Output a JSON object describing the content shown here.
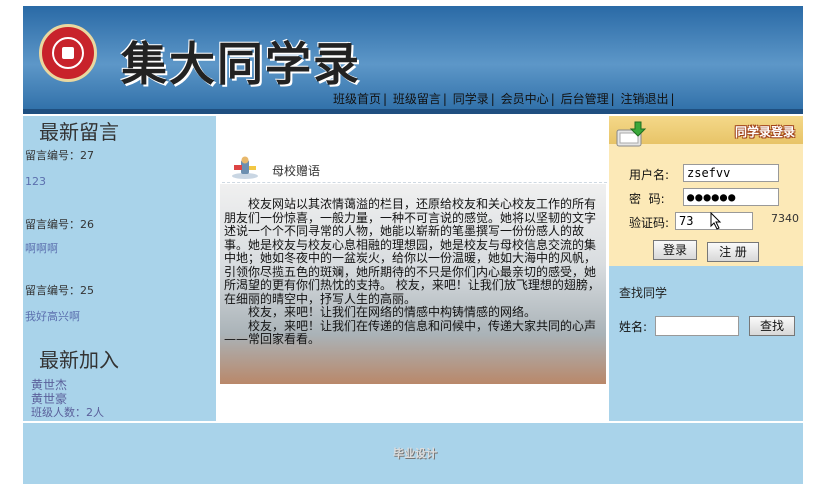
{
  "header": {
    "title": "集大同学录",
    "nav": [
      "班级首页",
      "班级留言",
      "同学录",
      "会员中心",
      "后台管理",
      "注销退出"
    ]
  },
  "left": {
    "latest_messages_title": "最新留言",
    "messages": [
      {
        "number": "留言编号：27",
        "body": "123"
      },
      {
        "number": "留言编号：26",
        "body": "啊啊啊"
      },
      {
        "number": "留言编号：25",
        "body": "我好高兴啊"
      }
    ],
    "latest_members_title": "最新加入",
    "members": [
      "黄世杰",
      "黄世豪"
    ],
    "class_count": "班级人数：2人"
  },
  "middle": {
    "title": "母校赠语",
    "paragraphs": [
      "校友网站以其浓情蔼溢的栏目，还原给校友和关心校友工作的所有朋友们一份惊喜，一般力量，一种不可言说的感觉。她将以坚韧的文字述说一个个不同寻常的人物，她能以崭新的笔墨撰写一份份感人的故事。她是校友与校友心息相融的理想园，她是校友与母校信息交流的集中地；她如冬夜中的一盆炭火，给你以一份温暖，她如大海中的风帆，引领你尽揽五色的斑斓，她所期待的不只是你们内心最亲切的感受，她所渴望的更有你们热忱的支持。 校友，来吧！让我们放飞理想的翅膀，在细丽的晴空中，抒写人生的高丽。",
      "校友，来吧！让我们在网络的情感中构铸情感的网络。",
      "校友，来吧！让我们在传递的信息和问候中，传递大家共同的心声——常回家看看。"
    ]
  },
  "login": {
    "title": "同学录登录",
    "username_label": "用户名:",
    "username_value": "zsefvv",
    "password_label": "密  码:",
    "password_value": "●●●●●●",
    "captcha_label": "验证码:",
    "captcha_value": "73",
    "captcha_code": "7340",
    "login_button": "登录",
    "register_button": "注 册"
  },
  "search": {
    "title": "查找同学",
    "name_label": "姓名:",
    "name_value": "",
    "button": "查找"
  },
  "footer": {
    "text": "毕业设计"
  }
}
